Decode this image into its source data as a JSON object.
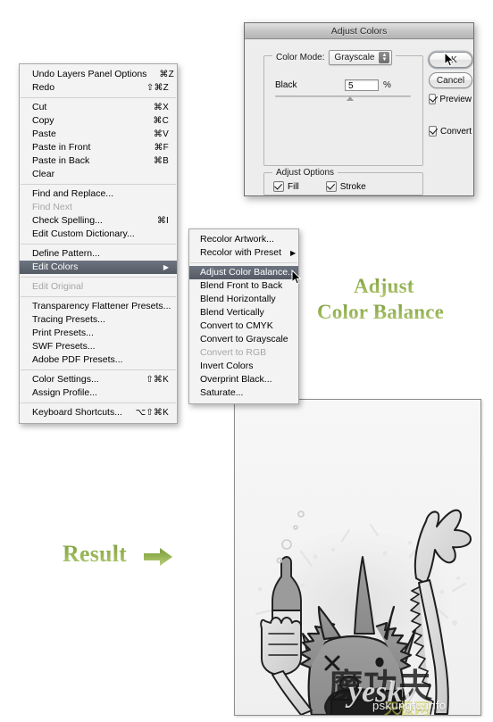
{
  "edit_menu": {
    "items": [
      {
        "label": "Undo Layers Panel Options",
        "shortcut": "⌘Z",
        "state": "normal"
      },
      {
        "label": "Redo",
        "shortcut": "⇧⌘Z",
        "state": "normal"
      },
      {
        "separator": true
      },
      {
        "label": "Cut",
        "shortcut": "⌘X",
        "state": "normal"
      },
      {
        "label": "Copy",
        "shortcut": "⌘C",
        "state": "normal"
      },
      {
        "label": "Paste",
        "shortcut": "⌘V",
        "state": "normal"
      },
      {
        "label": "Paste in Front",
        "shortcut": "⌘F",
        "state": "normal"
      },
      {
        "label": "Paste in Back",
        "shortcut": "⌘B",
        "state": "normal"
      },
      {
        "label": "Clear",
        "shortcut": "",
        "state": "normal"
      },
      {
        "separator": true
      },
      {
        "label": "Find and Replace...",
        "shortcut": "",
        "state": "normal"
      },
      {
        "label": "Find Next",
        "shortcut": "",
        "state": "disabled"
      },
      {
        "label": "Check Spelling...",
        "shortcut": "⌘I",
        "state": "normal"
      },
      {
        "label": "Edit Custom Dictionary...",
        "shortcut": "",
        "state": "normal"
      },
      {
        "separator": true
      },
      {
        "label": "Define Pattern...",
        "shortcut": "",
        "state": "normal"
      },
      {
        "label": "Edit Colors",
        "shortcut": "",
        "state": "selected",
        "submenu": true
      },
      {
        "separator": true
      },
      {
        "label": "Edit Original",
        "shortcut": "",
        "state": "disabled"
      },
      {
        "separator": true
      },
      {
        "label": "Transparency Flattener Presets...",
        "shortcut": "",
        "state": "normal"
      },
      {
        "label": "Tracing Presets...",
        "shortcut": "",
        "state": "normal"
      },
      {
        "label": "Print Presets...",
        "shortcut": "",
        "state": "normal"
      },
      {
        "label": "SWF Presets...",
        "shortcut": "",
        "state": "normal"
      },
      {
        "label": "Adobe PDF Presets...",
        "shortcut": "",
        "state": "normal"
      },
      {
        "separator": true
      },
      {
        "label": "Color Settings...",
        "shortcut": "⇧⌘K",
        "state": "normal"
      },
      {
        "label": "Assign Profile...",
        "shortcut": "",
        "state": "normal"
      },
      {
        "separator": true
      },
      {
        "label": "Keyboard Shortcuts...",
        "shortcut": "⌥⇧⌘K",
        "state": "normal"
      }
    ]
  },
  "sub_menu": {
    "items": [
      {
        "label": "Recolor Artwork...",
        "state": "normal"
      },
      {
        "label": "Recolor with Preset",
        "state": "normal",
        "submenu": true
      },
      {
        "separator": true
      },
      {
        "label": "Adjust Color Balance...",
        "state": "selected"
      },
      {
        "label": "Blend Front to Back",
        "state": "normal"
      },
      {
        "label": "Blend Horizontally",
        "state": "normal"
      },
      {
        "label": "Blend Vertically",
        "state": "normal"
      },
      {
        "label": "Convert to CMYK",
        "state": "normal"
      },
      {
        "label": "Convert to Grayscale",
        "state": "normal"
      },
      {
        "label": "Convert to RGB",
        "state": "disabled"
      },
      {
        "label": "Invert Colors",
        "state": "normal"
      },
      {
        "label": "Overprint Black...",
        "state": "normal"
      },
      {
        "label": "Saturate...",
        "state": "normal"
      }
    ]
  },
  "dialog": {
    "title": "Adjust Colors",
    "color_mode_label": "Color Mode:",
    "color_mode_value": "Grayscale",
    "color_mode_options": [
      "Grayscale"
    ],
    "slider_label": "Black",
    "slider_value": "5",
    "percent_symbol": "%",
    "adjust_options_legend": "Adjust Options",
    "checkboxes": [
      {
        "label": "Fill",
        "checked": true
      },
      {
        "label": "Stroke",
        "checked": true
      }
    ],
    "buttons": [
      {
        "label": "OK",
        "default": true
      },
      {
        "label": "Cancel",
        "default": false
      }
    ],
    "right_checkboxes": [
      {
        "label": "Preview",
        "checked": true
      },
      {
        "label": "Convert",
        "checked": true
      }
    ]
  },
  "annotations": {
    "adjust": "Adjust",
    "color_balance": "Color Balance",
    "result": "Result",
    "accent_color": "#91b04f"
  },
  "watermark": {
    "cn_brand": "魔功夫",
    "latin_brand": "yesky",
    "url": "pskungfu.info",
    "cn_sub": "天极网"
  }
}
